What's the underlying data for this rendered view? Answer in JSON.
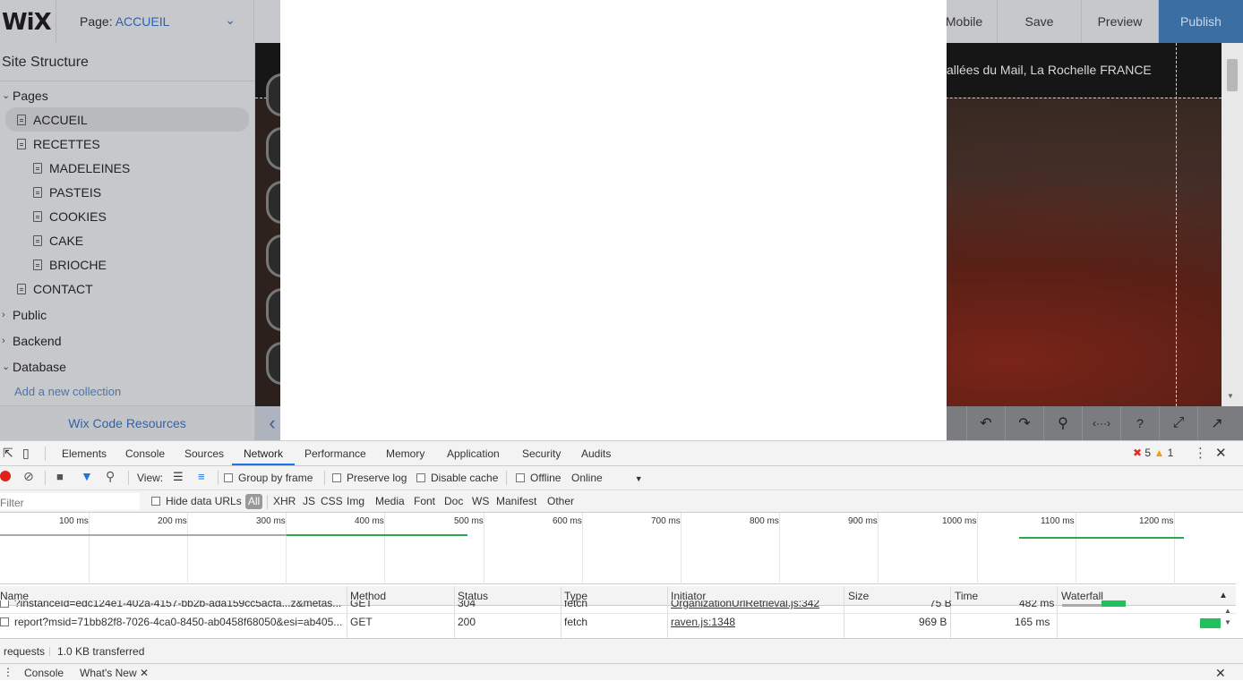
{
  "wix": {
    "logo": "WiX",
    "page_label": "Page:",
    "page_value": "ACCUEIL",
    "buttons": {
      "mobile": "Mobile",
      "save": "Save",
      "preview": "Preview",
      "publish": "Publish"
    }
  },
  "sidebar": {
    "title": "Site Structure",
    "pages_label": "Pages",
    "pages": [
      "ACCUEIL",
      "RECETTES",
      "MADELEINES",
      "PASTEIS",
      "COOKIES",
      "CAKE",
      "BRIOCHE",
      "CONTACT"
    ],
    "sections": [
      "Public",
      "Backend",
      "Database"
    ],
    "add_collection": "Add a new collection",
    "code_resources": "Wix Code Resources"
  },
  "canvas": {
    "address": "allées du Mail, La Rochelle  FRANCE"
  },
  "devtools": {
    "tabs": [
      "Elements",
      "Console",
      "Sources",
      "Network",
      "Performance",
      "Memory",
      "Application",
      "Security",
      "Audits"
    ],
    "active_tab": "Network",
    "errors": "5",
    "warnings": "1",
    "toolbar": {
      "view_label": "View:",
      "group_by_frame": "Group by frame",
      "preserve_log": "Preserve log",
      "disable_cache": "Disable cache",
      "offline": "Offline",
      "throttle": "Online"
    },
    "filter": {
      "placeholder": "Filter",
      "hide_data_urls": "Hide data URLs",
      "types": [
        "All",
        "XHR",
        "JS",
        "CSS",
        "Img",
        "Media",
        "Font",
        "Doc",
        "WS",
        "Manifest",
        "Other"
      ]
    },
    "timeline_ticks": [
      "100 ms",
      "200 ms",
      "300 ms",
      "400 ms",
      "500 ms",
      "600 ms",
      "700 ms",
      "800 ms",
      "900 ms",
      "1000 ms",
      "1100 ms",
      "1200 ms"
    ],
    "columns": [
      "Name",
      "Method",
      "Status",
      "Type",
      "Initiator",
      "Size",
      "Time",
      "Waterfall"
    ],
    "rows": [
      {
        "name": "?instanceId=edc124e1-402a-4157-bb2b-ada159cc5acfa...z&metas...",
        "method": "GET",
        "status": "304",
        "type": "fetch",
        "initiator": "OrganizationUrlRetrieval.js:342",
        "size": "75 B",
        "time": "482 ms"
      },
      {
        "name": "report?msid=71bb82f8-7026-4ca0-8450-ab0458f68050&esi=ab405...",
        "method": "GET",
        "status": "200",
        "type": "fetch",
        "initiator": "raven.js:1348",
        "size": "969 B",
        "time": "165 ms"
      }
    ],
    "summary": {
      "requests": "requests",
      "transferred": "1.0 KB transferred"
    },
    "drawer_tabs": [
      "Console",
      "What's New"
    ]
  }
}
